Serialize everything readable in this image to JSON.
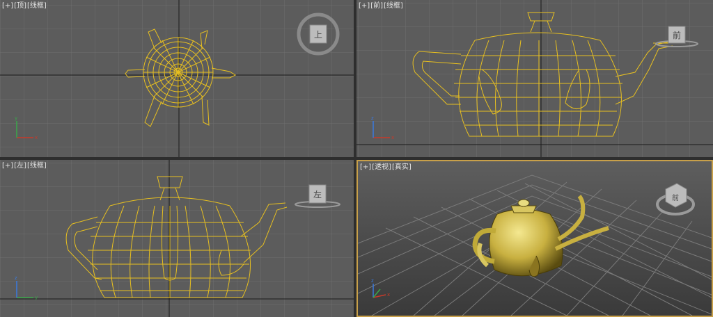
{
  "viewports": [
    {
      "id": "top",
      "plus": "[+]",
      "name": "[顶]",
      "mode": "[线框]",
      "cube_label": "上"
    },
    {
      "id": "front",
      "plus": "[+]",
      "name": "[前]",
      "mode": "[线框]",
      "cube_label": "前"
    },
    {
      "id": "left",
      "plus": "[+]",
      "name": "[左]",
      "mode": "[线框]",
      "cube_label": "左"
    },
    {
      "id": "persp",
      "plus": "[+]",
      "name": "[透视]",
      "mode": "[真实]",
      "cube_label": "前"
    }
  ],
  "colors": {
    "wire": "#e8c020",
    "grid": "#707070",
    "axis_dark": "#1a1a1a",
    "active_border": "#c8a04a"
  },
  "axis_labels": {
    "x": "x",
    "y": "y",
    "z": "z"
  }
}
